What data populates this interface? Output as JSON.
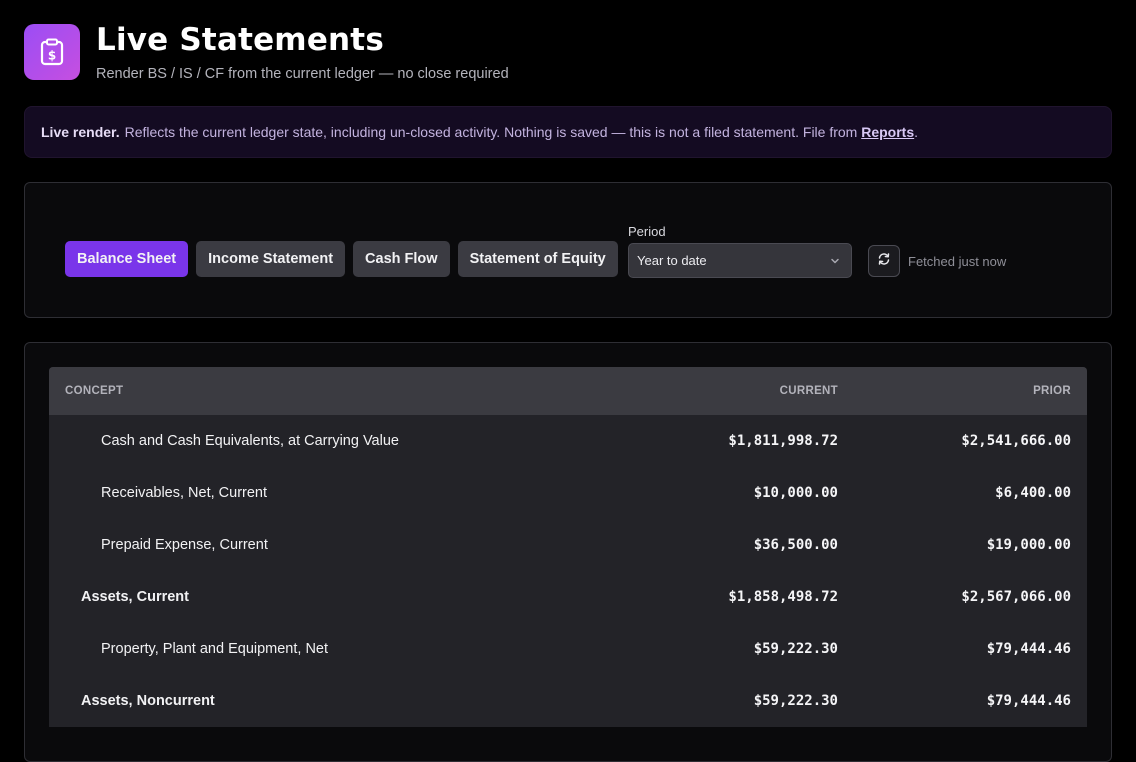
{
  "header": {
    "icon": "clipboard-dollar-icon",
    "title": "Live Statements",
    "subtitle": "Render BS / IS / CF from the current ledger — no close required"
  },
  "banner": {
    "strong": "Live render.",
    "text": "Reflects the current ledger state, including un-closed activity. Nothing is saved — this is not a filed statement. File from ",
    "link": "Reports",
    "suffix": "."
  },
  "controls": {
    "tabs": [
      {
        "label": "Balance Sheet",
        "active": true
      },
      {
        "label": "Income Statement",
        "active": false
      },
      {
        "label": "Cash Flow",
        "active": false
      },
      {
        "label": "Statement of Equity",
        "active": false
      }
    ],
    "period_label": "Period",
    "period_value": "Year to date",
    "refresh_icon": "refresh-icon",
    "fetched": "Fetched just now"
  },
  "table": {
    "columns": {
      "concept": "CONCEPT",
      "current": "CURRENT",
      "prior": "PRIOR"
    },
    "rows": [
      {
        "concept": "Cash and Cash Equivalents, at Carrying Value",
        "current": "$1,811,998.72",
        "prior": "$2,541,666.00",
        "level": 2
      },
      {
        "concept": "Receivables, Net, Current",
        "current": "$10,000.00",
        "prior": "$6,400.00",
        "level": 2
      },
      {
        "concept": "Prepaid Expense, Current",
        "current": "$36,500.00",
        "prior": "$19,000.00",
        "level": 2
      },
      {
        "concept": "Assets, Current",
        "current": "$1,858,498.72",
        "prior": "$2,567,066.00",
        "level": 1
      },
      {
        "concept": "Property, Plant and Equipment, Net",
        "current": "$59,222.30",
        "prior": "$79,444.46",
        "level": 2
      },
      {
        "concept": "Assets, Noncurrent",
        "current": "$59,222.30",
        "prior": "$79,444.46",
        "level": 1
      }
    ]
  },
  "colors": {
    "accent": "#7a35ea",
    "icon_gradient_start": "#9b4df5",
    "icon_gradient_end": "#c64fe0",
    "banner_bg": "#140b22"
  }
}
